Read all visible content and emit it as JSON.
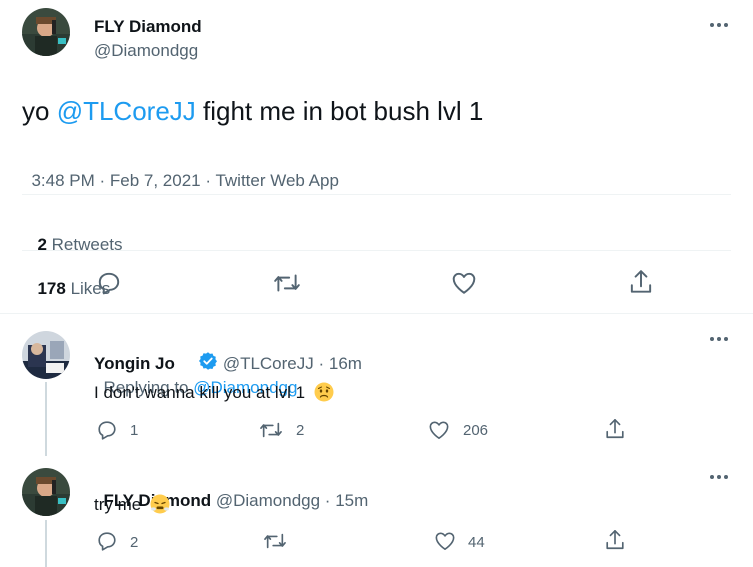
{
  "main_tweet": {
    "author_name": "FLY Diamond",
    "handle": "@Diamondgg",
    "text_prefix": "yo ",
    "mention": "@TLCoreJJ",
    "text_suffix": " fight me in bot bush lvl 1",
    "time": "3:48 PM",
    "sep1": " · ",
    "date": "Feb 7, 2021",
    "sep2": " · ",
    "source": "Twitter Web App",
    "retweets_count": "2",
    "retweets_label": "Retweets",
    "likes_count": "178",
    "likes_label": "Likes"
  },
  "replies": [
    {
      "author_name": "Yongin Jo",
      "verified": true,
      "handle": "@TLCoreJJ",
      "dot": " · ",
      "time": "16m",
      "replying_label": "Replying to ",
      "replying_to": "@Diamondgg",
      "text": "I don't wanna kill you at lvl 1",
      "emoji": "worried-face",
      "reply_count": "1",
      "retweet_count": "2",
      "like_count": "206"
    },
    {
      "author_name": "FLY Diamond",
      "handle": "@Diamondgg",
      "dot": " · ",
      "time": "15m",
      "text": "try me",
      "emoji": "face-with-steam",
      "reply_count": "2",
      "retweet_count": "",
      "like_count": "44"
    }
  ],
  "colors": {
    "text": "#0f1419",
    "muted": "#536471",
    "link": "#1d9bf0",
    "divider": "#eff3f4",
    "verified": "#1d9bf0"
  }
}
